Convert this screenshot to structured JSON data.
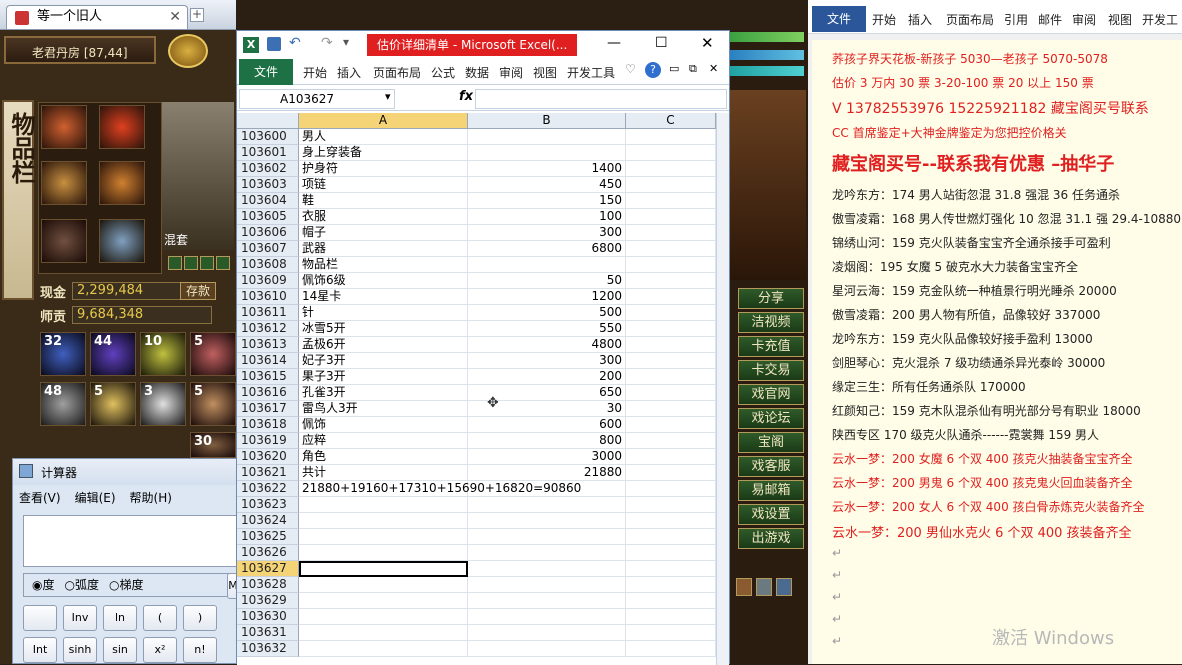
{
  "browser": {
    "tab_label": "等一个旧人"
  },
  "game": {
    "location": "老君丹房 [87,44]",
    "side_label": "物品栏",
    "char_label": "混套",
    "cash_label": "现金",
    "cash_value": "2,299,484",
    "deposit_button": "存款",
    "tribute_label": "师贡",
    "tribute_value": "9,684,348",
    "slots": [
      "32",
      "44",
      "10",
      "5",
      "48",
      "5",
      "3",
      "5",
      "30"
    ],
    "menu": [
      "分享",
      "洁视频",
      "卡充值",
      "卡交易",
      "戏官网",
      "戏论坛",
      "宝阁",
      "戏客服",
      "易邮箱",
      "戏设置",
      "出游戏"
    ]
  },
  "excel": {
    "title": "估价详细清单 - Microsoft Excel(...",
    "tabs": [
      "文件",
      "开始",
      "插入",
      "页面布局",
      "公式",
      "数据",
      "审阅",
      "视图",
      "开发工具"
    ],
    "namebox": "A103627",
    "columns": [
      "A",
      "B",
      "C"
    ],
    "rows": [
      {
        "n": "103600",
        "a": "男人",
        "b": ""
      },
      {
        "n": "103601",
        "a": "身上穿装备",
        "b": ""
      },
      {
        "n": "103602",
        "a": "护身符",
        "b": "1400"
      },
      {
        "n": "103603",
        "a": "项链",
        "b": "450"
      },
      {
        "n": "103604",
        "a": "鞋",
        "b": "150"
      },
      {
        "n": "103605",
        "a": "衣服",
        "b": "100"
      },
      {
        "n": "103606",
        "a": "帽子",
        "b": "300"
      },
      {
        "n": "103607",
        "a": "武器",
        "b": "6800"
      },
      {
        "n": "103608",
        "a": "物品栏",
        "b": ""
      },
      {
        "n": "103609",
        "a": "佩饰6级",
        "b": "50"
      },
      {
        "n": "103610",
        "a": "14星卡",
        "b": "1200"
      },
      {
        "n": "103611",
        "a": "针",
        "b": "500"
      },
      {
        "n": "103612",
        "a": "冰雪5开",
        "b": "550"
      },
      {
        "n": "103613",
        "a": "孟极6开",
        "b": "4800"
      },
      {
        "n": "103614",
        "a": "妃子3开",
        "b": "300"
      },
      {
        "n": "103615",
        "a": "果子3开",
        "b": "200"
      },
      {
        "n": "103616",
        "a": "孔雀3开",
        "b": "650"
      },
      {
        "n": "103617",
        "a": "雷鸟人3开",
        "b": "30"
      },
      {
        "n": "103618",
        "a": "佩饰",
        "b": "600"
      },
      {
        "n": "103619",
        "a": "应粹",
        "b": "800"
      },
      {
        "n": "103620",
        "a": "角色",
        "b": "3000"
      },
      {
        "n": "103621",
        "a": "共计",
        "b": "21880"
      },
      {
        "n": "103622",
        "a": "21880+19160+17310+15690+16820=90860",
        "b": ""
      },
      {
        "n": "103623",
        "a": "",
        "b": ""
      },
      {
        "n": "103624",
        "a": "",
        "b": ""
      },
      {
        "n": "103625",
        "a": "",
        "b": ""
      },
      {
        "n": "103626",
        "a": "",
        "b": ""
      },
      {
        "n": "103627",
        "a": "",
        "b": ""
      },
      {
        "n": "103628",
        "a": "",
        "b": ""
      },
      {
        "n": "103629",
        "a": "",
        "b": ""
      },
      {
        "n": "103630",
        "a": "",
        "b": ""
      },
      {
        "n": "103631",
        "a": "",
        "b": ""
      },
      {
        "n": "103632",
        "a": "",
        "b": ""
      }
    ]
  },
  "calc": {
    "title": "计算器",
    "menu": [
      "查看(V)",
      "编辑(E)",
      "帮助(H)"
    ],
    "modes": [
      "度",
      "弧度",
      "梯度"
    ],
    "mem": "M",
    "row1": [
      "",
      "Inv",
      "ln",
      "(",
      ")"
    ],
    "row2": [
      "Int",
      "sinh",
      "sin",
      "x²",
      "n!"
    ]
  },
  "word": {
    "tabs": [
      "文件",
      "开始",
      "插入",
      "页面布局",
      "引用",
      "邮件",
      "审阅",
      "视图",
      "开发工"
    ],
    "lines": [
      {
        "t": "荞孩子界天花板-新孩子 5030—老孩子 5070-5078",
        "c": "red"
      },
      {
        "t": "估价 3 万内 30 票    3-20-100 票      20 以上 150 票",
        "c": "red"
      },
      {
        "t": "V 13782553976   15225921182  藏宝阁买号联系",
        "c": "red"
      },
      {
        "t": "CC 首席鉴定+大神金牌鉴定为您把控价格关",
        "c": "red"
      },
      {
        "t": "藏宝阁买号--联系我有优惠 –抽华子",
        "c": "red"
      },
      {
        "t": "龙吟东方：174 男人站街忽混 31.8 强混 36 任务通杀",
        "c": ""
      },
      {
        "t": "傲雪凌霜：168 男人传世燃灯强化 10 忽混 31.1 强 29.4-10880",
        "c": ""
      },
      {
        "t": "锦绣山河：159 克火队装备宝宝齐全通杀接手可盈利",
        "c": ""
      },
      {
        "t": "凌烟阁：195 女魔 5 破克水大力装备宝宝齐全",
        "c": ""
      },
      {
        "t": "星河云海：159 克金队统一种植景行明光睡杀 20000",
        "c": ""
      },
      {
        "t": "傲雪凌霜：200 男人物有所值，品像较好 337000",
        "c": ""
      },
      {
        "t": "龙吟东方：159 克火队品像较好接手盈利 13000",
        "c": ""
      },
      {
        "t": "剑胆琴心：克火混杀 7 级功绩通杀异光泰岭 30000",
        "c": ""
      },
      {
        "t": "缘定三生：所有任务通杀队 170000",
        "c": ""
      },
      {
        "t": "红颜知己：159 克木队混杀仙有明光部分号有职业 18000",
        "c": ""
      },
      {
        "t": "陕西专区 170 级克火队通杀------霓裳舞 159 男人",
        "c": ""
      },
      {
        "t": "云水一梦：200 女魔 6 个双 400 孩克火抽装备宝宝齐全",
        "c": "red"
      },
      {
        "t": "云水一梦：200 男鬼 6 个双 400 孩克鬼火回血装备齐全",
        "c": "red"
      },
      {
        "t": "云水一梦：200 女人 6 个双 400 孩白骨赤炼克火装备齐全",
        "c": "red"
      },
      {
        "t": "云水一梦：200 男仙水克火 6 个双 400 孩装备齐全",
        "c": "red"
      }
    ],
    "watermark": "激活 Windows"
  }
}
